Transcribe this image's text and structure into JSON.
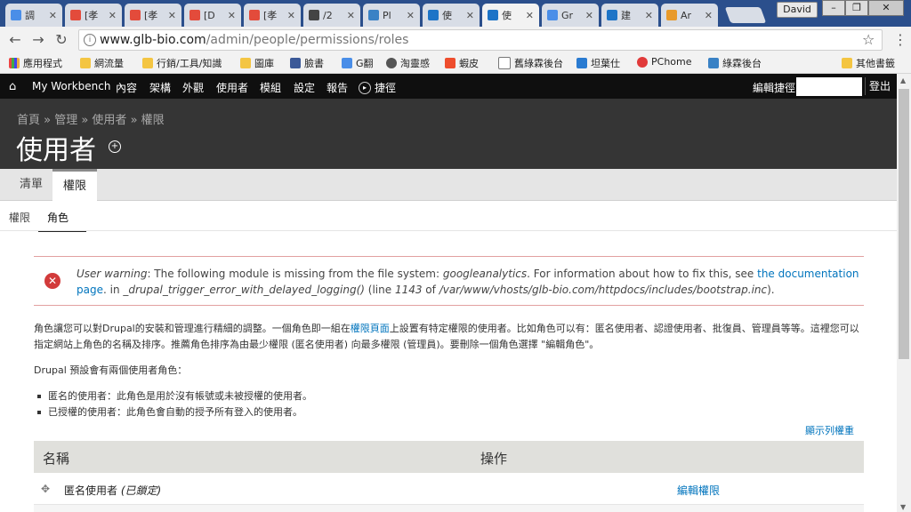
{
  "browser": {
    "tabs": [
      {
        "label": "調",
        "favicon": "#4a8ee8"
      },
      {
        "label": "[孝",
        "favicon": "#e34b3b"
      },
      {
        "label": "[孝",
        "favicon": "#e34b3b"
      },
      {
        "label": "[D",
        "favicon": "#e34b3b"
      },
      {
        "label": "[孝",
        "favicon": "#e34b3b"
      },
      {
        "label": "/2",
        "favicon": "#444444"
      },
      {
        "label": "Pl",
        "favicon": "#3a82c5"
      },
      {
        "label": "使",
        "favicon": "#1d74c7"
      },
      {
        "label": "使",
        "favicon": "#1d74c7"
      },
      {
        "label": "Gr",
        "favicon": "#4a8ee8"
      },
      {
        "label": "建",
        "favicon": "#1d74c7"
      },
      {
        "label": "Ar",
        "favicon": "#e89a2b"
      }
    ],
    "profile_name": "David",
    "url_host": "www.glb-bio.com",
    "url_path": "/admin/people/permissions/roles",
    "bookmarks": [
      "應用程式",
      "網流量",
      "行銷/工具/知識",
      "圖庫",
      "臉書",
      "G翻",
      "淘靈感",
      "蝦皮",
      "舊綠霖後台",
      "坦葉仕",
      "PChome",
      "綠霖後台",
      "其他書籤"
    ]
  },
  "admin_toolbar": {
    "items": [
      "My Workbench",
      "內容",
      "架構",
      "外觀",
      "使用者",
      "模組",
      "設定",
      "報告",
      "捷徑"
    ],
    "edit_shortcuts": "編輯捷徑",
    "logout": "登出"
  },
  "page": {
    "breadcrumb": "首頁 » 管理 » 使用者 » 權限",
    "title": "使用者",
    "primary_tabs": [
      "清單",
      "權限"
    ],
    "secondary_tabs": [
      "權限",
      "角色"
    ],
    "warning": {
      "prefix": "User warning",
      "message": ": The following module is missing from the file system: ",
      "module": "googleanalytics",
      "message2": ". For information about how to fix this, see ",
      "link": "the documentation page",
      "message3": ". in ",
      "func": "_drupal_trigger_error_with_delayed_logging()",
      "message4": " (line ",
      "line": "1143",
      "message5": " of ",
      "file": "/var/www/vhosts/glb-bio.com/httpdocs/includes/bootstrap.inc",
      "message6": ")."
    },
    "description_a": "角色讓您可以對Drupal的安裝和管理進行精細的調整。一個角色即一組在",
    "description_link": "權限頁面",
    "description_b": "上設置有特定權限的使用者。比如角色可以有：匿名使用者、認證使用者、批復員、管理員等等。這裡您可以指定網站上角色的名稱及排序。推薦角色排序為由最少權限 (匿名使用者) 向最多權限 (管理員)。要刪除一個角色選擇 \"編輯角色\"。",
    "default_roles_intro": "Drupal 預設會有兩個使用者角色：",
    "default_roles": [
      "匿名的使用者：此角色是用於沒有帳號或未被授權的使用者。",
      "已授權的使用者：此角色會自動的授予所有登入的使用者。"
    ],
    "show_weights": "顯示列權重",
    "table": {
      "headers": [
        "名稱",
        "操作"
      ],
      "rows": [
        {
          "name": "匿名使用者",
          "locked": "(已鎖定)",
          "action": "編輯權限"
        }
      ]
    }
  }
}
